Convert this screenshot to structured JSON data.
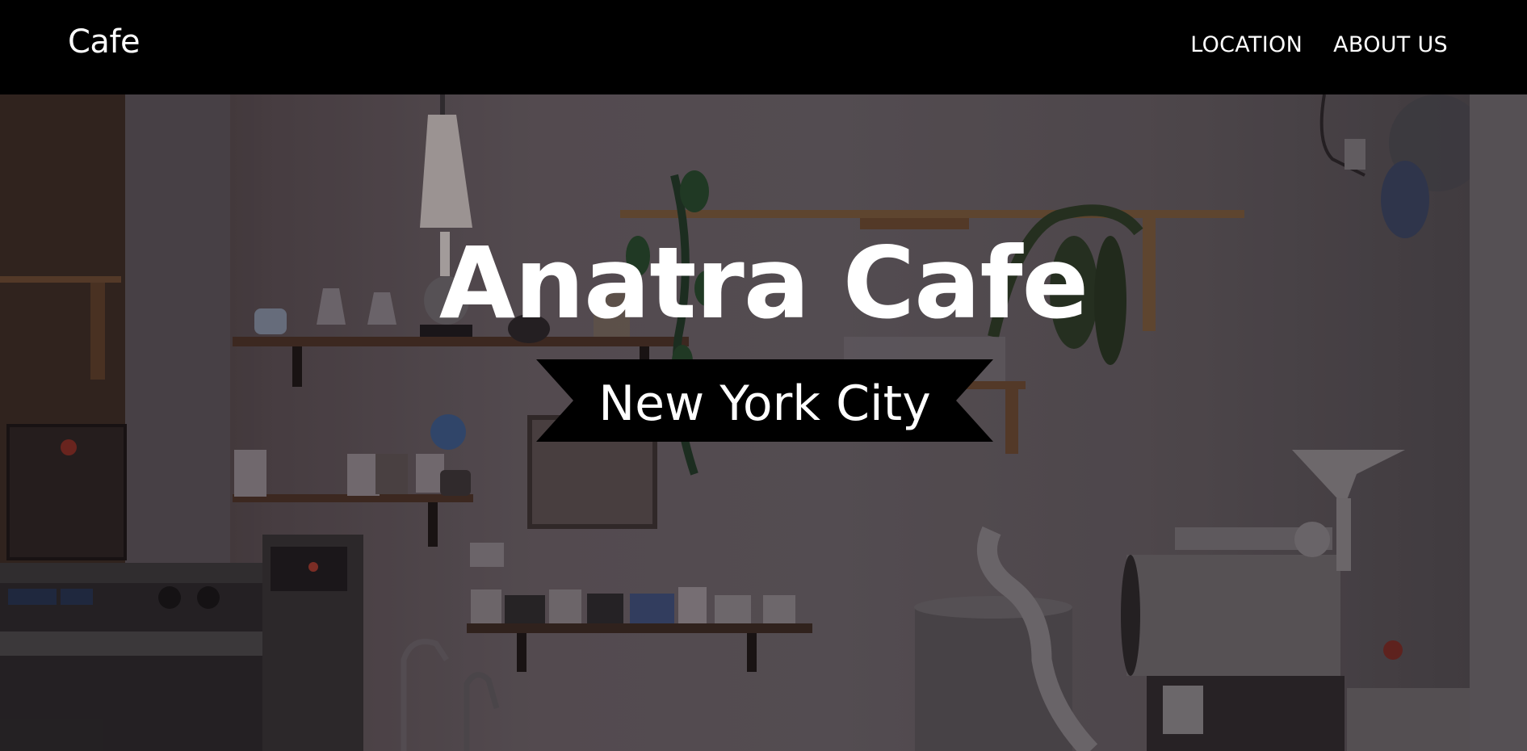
{
  "navbar": {
    "brand": "Cafe",
    "links": [
      {
        "label": "LOCATION"
      },
      {
        "label": "ABOUT US"
      }
    ]
  },
  "hero": {
    "title": "Anatra Cafe",
    "subtitle": "New York City",
    "background": "cafe-interior-photo"
  },
  "colors": {
    "navbar_bg": "#000000",
    "text": "#ffffff",
    "ribbon_bg": "#000000"
  }
}
